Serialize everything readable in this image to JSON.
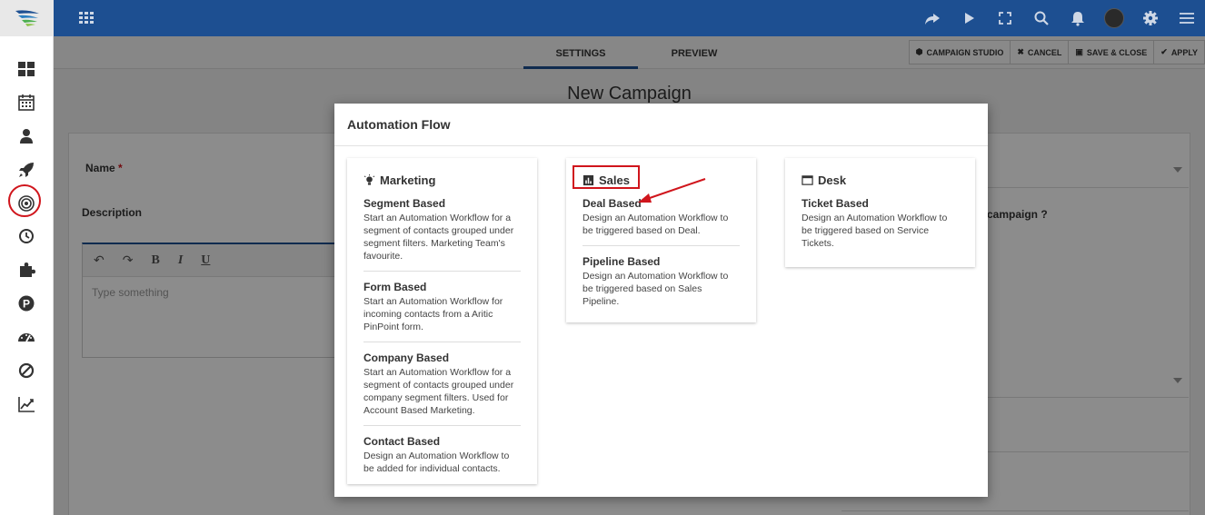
{
  "topbar": {
    "icons": [
      "share-icon",
      "play-icon",
      "fullscreen-icon",
      "search-icon",
      "bell-icon",
      "avatar",
      "gear-icon",
      "menu-icon"
    ]
  },
  "sidebar": {
    "icons": [
      "dashboard-icon",
      "calendar-icon",
      "user-icon",
      "rocket-icon",
      "target-icon",
      "clock-icon",
      "puzzle-icon",
      "pinpoint-icon",
      "speedometer-icon",
      "ban-icon",
      "chart-icon"
    ]
  },
  "subbar": {
    "tab_settings": "SETTINGS",
    "tab_preview": "PREVIEW",
    "campaign_studio": "CAMPAIGN STUDIO",
    "cancel": "CANCEL",
    "save_close": "SAVE & CLOSE",
    "apply": "APPLY"
  },
  "page": {
    "title": "New Campaign",
    "name_label": "Name",
    "required_mark": "*",
    "description_label": "Description",
    "editor_placeholder": "Type something",
    "editor_bold": "B",
    "editor_italic": "I",
    "editor_underline": "U",
    "right_label": "campaign"
  },
  "modal": {
    "title": "Automation Flow",
    "marketing": {
      "title": "Marketing",
      "items": [
        {
          "title": "Segment Based",
          "desc": "Start an Automation Workflow for a segment of contacts grouped under segment filters. Marketing Team's favourite."
        },
        {
          "title": "Form Based",
          "desc": "Start an Automation Workflow for incoming contacts from a Aritic PinPoint form."
        },
        {
          "title": "Company Based",
          "desc": "Start an Automation Workflow for a segment of contacts grouped under company segment filters. Used for Account Based Marketing."
        },
        {
          "title": "Contact Based",
          "desc": "Design an Automation Workflow to be added for individual contacts."
        }
      ]
    },
    "sales": {
      "title": "Sales",
      "items": [
        {
          "title": "Deal Based",
          "desc": "Design an Automation Workflow to be triggered based on Deal."
        },
        {
          "title": "Pipeline Based",
          "desc": "Design an Automation Workflow to be triggered based on Sales Pipeline."
        }
      ]
    },
    "desk": {
      "title": "Desk",
      "items": [
        {
          "title": "Ticket Based",
          "desc": "Design an Automation Workflow to be triggered based on Service Tickets."
        }
      ]
    }
  },
  "colors": {
    "brand": "#1d4f91",
    "highlight": "#d0151c"
  }
}
